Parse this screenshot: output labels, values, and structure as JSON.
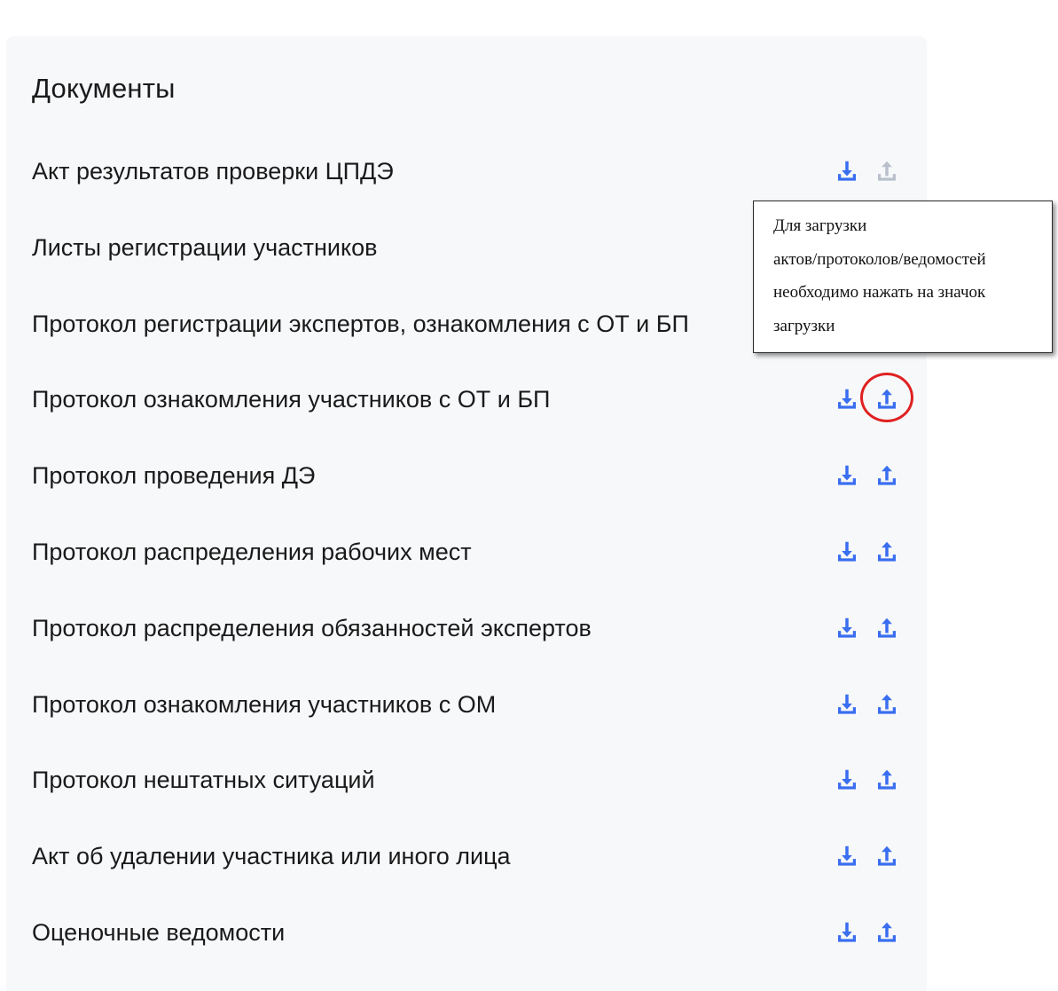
{
  "panel": {
    "title": "Документы"
  },
  "documents": [
    {
      "label": "Акт результатов проверки ЦПДЭ",
      "upload_enabled": false
    },
    {
      "label": "Листы регистрации участников",
      "upload_enabled": true
    },
    {
      "label": "Протокол регистрации экспертов, ознакомления с ОТ и БП",
      "upload_enabled": true
    },
    {
      "label": "Протокол ознакомления участников с ОТ и БП",
      "upload_enabled": true
    },
    {
      "label": "Протокол проведения ДЭ",
      "upload_enabled": true
    },
    {
      "label": "Протокол распределения рабочих мест",
      "upload_enabled": true
    },
    {
      "label": "Протокол распределения обязанностей экспертов",
      "upload_enabled": true
    },
    {
      "label": "Протокол ознакомления участников с ОМ",
      "upload_enabled": true
    },
    {
      "label": "Протокол нештатных ситуаций",
      "upload_enabled": true
    },
    {
      "label": "Акт об удалении участника или иного лица",
      "upload_enabled": true
    },
    {
      "label": "Оценочные ведомости",
      "upload_enabled": true
    }
  ],
  "icons": {
    "download": "download-icon",
    "upload": "upload-icon"
  },
  "colors": {
    "icon_active": "#3a6ef0",
    "icon_disabled": "#b9c0cc",
    "highlight": "#e02020",
    "panel_bg": "#f7f8fa"
  },
  "tooltip": {
    "lines": [
      "Для загрузки",
      "актов/протоколов/ведомостей",
      "необходимо нажать на значок",
      "загрузки"
    ]
  }
}
